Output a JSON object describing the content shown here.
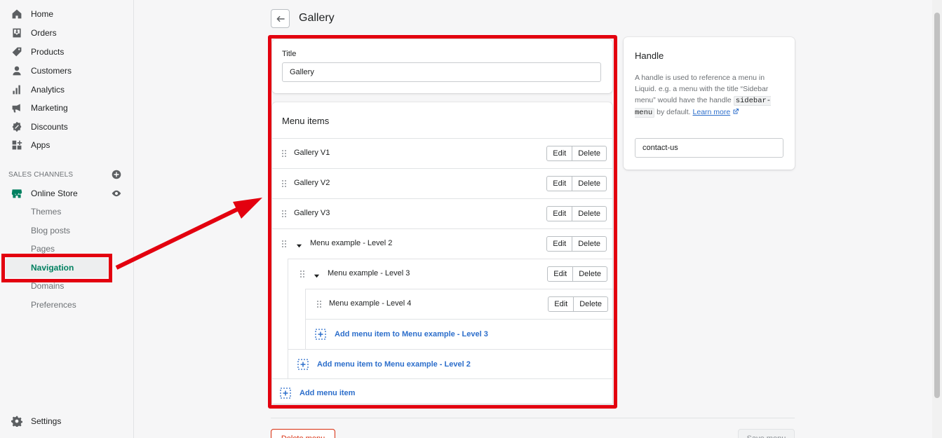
{
  "sidebar": {
    "items": [
      {
        "label": "Home",
        "icon": "home-icon"
      },
      {
        "label": "Orders",
        "icon": "orders-icon"
      },
      {
        "label": "Products",
        "icon": "tag-icon"
      },
      {
        "label": "Customers",
        "icon": "person-icon"
      },
      {
        "label": "Analytics",
        "icon": "bar-chart-icon"
      },
      {
        "label": "Marketing",
        "icon": "megaphone-icon"
      },
      {
        "label": "Discounts",
        "icon": "discount-icon"
      },
      {
        "label": "Apps",
        "icon": "apps-icon"
      }
    ],
    "sales_channels_label": "SALES CHANNELS",
    "online_store": {
      "label": "Online Store",
      "icon": "store-icon"
    },
    "online_store_subitems": [
      "Themes",
      "Blog posts",
      "Pages",
      "Navigation",
      "Domains",
      "Preferences"
    ],
    "active_subitem": "Navigation",
    "settings": {
      "label": "Settings",
      "icon": "gear-icon"
    }
  },
  "header": {
    "title": "Gallery"
  },
  "title_card": {
    "label": "Title",
    "value": "Gallery"
  },
  "menu_card": {
    "heading": "Menu items",
    "items": [
      {
        "label": "Gallery V1",
        "edit": "Edit",
        "delete": "Delete"
      },
      {
        "label": "Gallery V2",
        "edit": "Edit",
        "delete": "Delete"
      },
      {
        "label": "Gallery V3",
        "edit": "Edit",
        "delete": "Delete"
      },
      {
        "label": "Menu example - Level 2",
        "edit": "Edit",
        "delete": "Delete"
      },
      {
        "label": "Menu example - Level 3",
        "edit": "Edit",
        "delete": "Delete"
      },
      {
        "label": "Menu example - Level 4",
        "edit": "Edit",
        "delete": "Delete"
      }
    ],
    "add_level3": "Add menu item to Menu example - Level 3",
    "add_level2": "Add menu item to Menu example - Level 2",
    "add_item": "Add menu item"
  },
  "handle_card": {
    "title": "Handle",
    "help_before": "A handle is used to reference a menu in Liquid. e.g. a menu with the title “Sidebar menu” would have the handle ",
    "help_code": "sidebar-menu",
    "help_after": " by default. ",
    "learn_more": "Learn more",
    "value": "contact-us"
  },
  "footer": {
    "delete_menu": "Delete menu",
    "save_menu": "Save menu"
  },
  "colors": {
    "accent": "#008060",
    "link": "#2c6ecb",
    "highlight": "#e3000f",
    "danger": "#d82c0d"
  }
}
